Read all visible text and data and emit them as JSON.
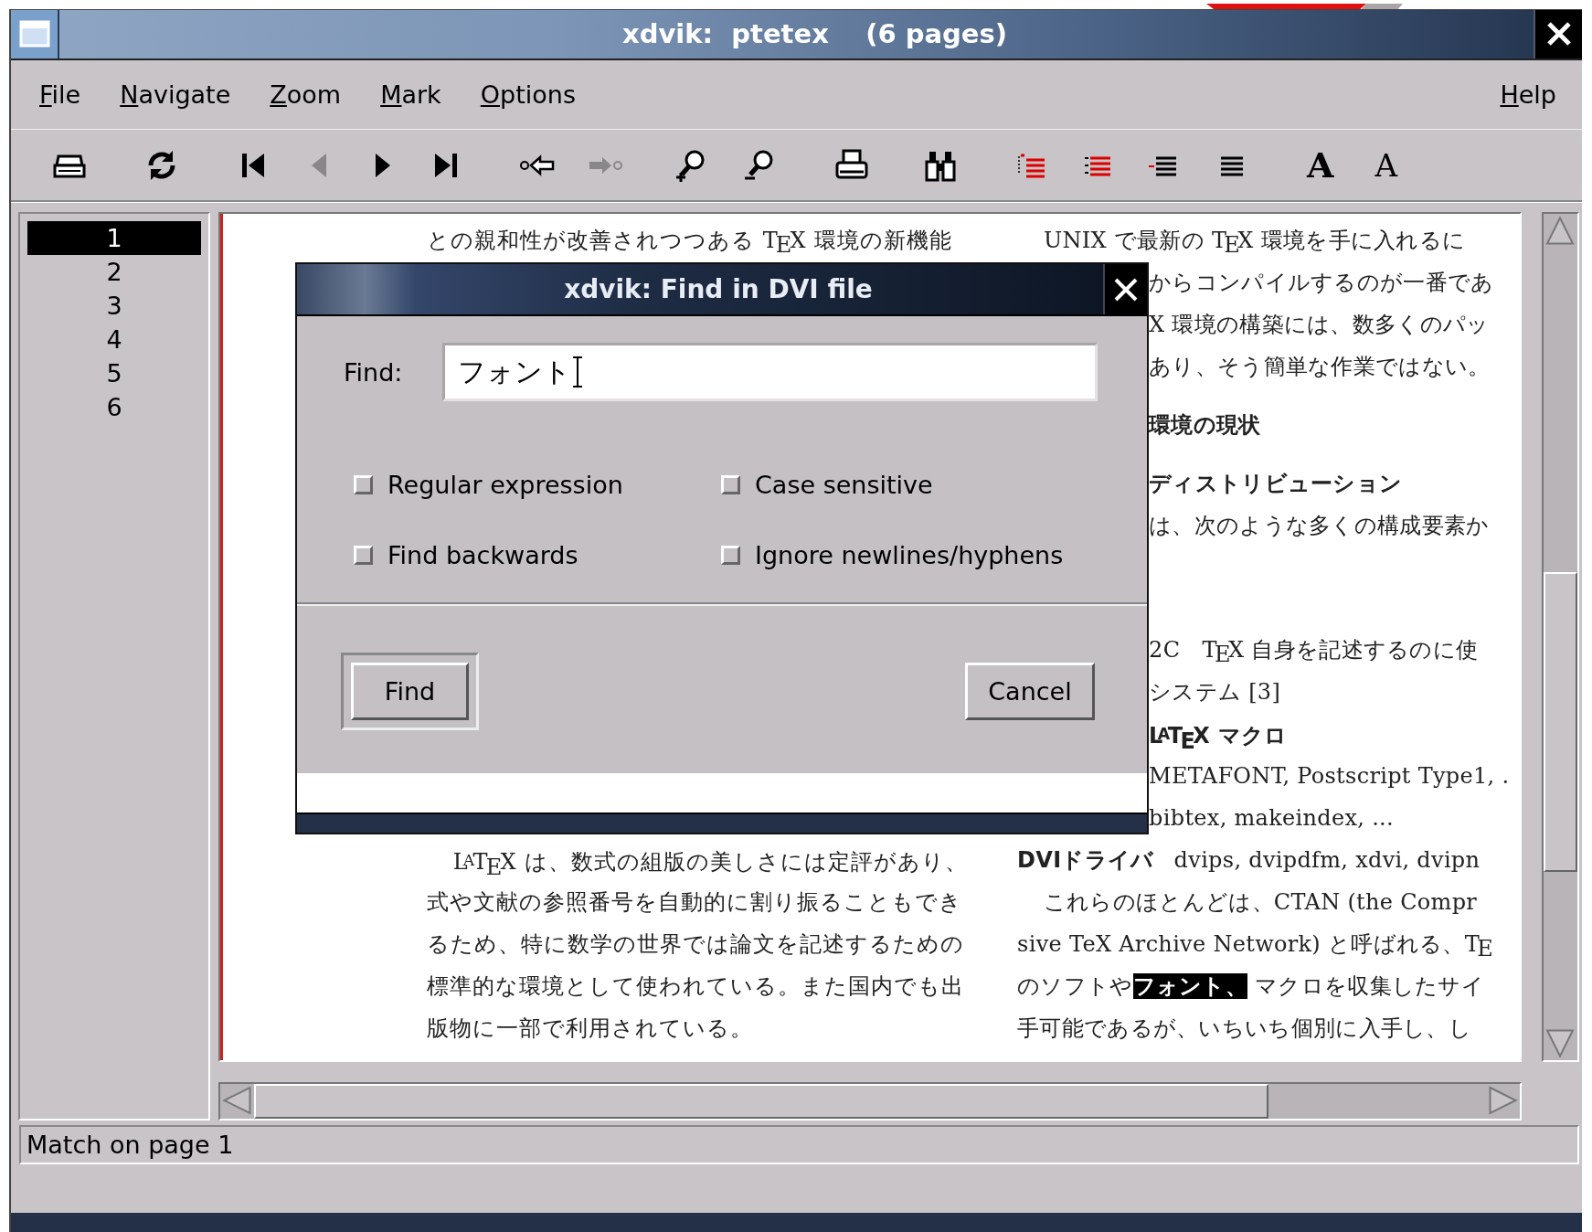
{
  "window": {
    "title": "xdvik:  ptetex    (6 pages)"
  },
  "menu": [
    {
      "label": "File"
    },
    {
      "label": "Navigate"
    },
    {
      "label": "Zoom"
    },
    {
      "label": "Mark"
    },
    {
      "label": "Options"
    }
  ],
  "help_menu": {
    "label": "Help"
  },
  "toolbar": [
    {
      "kind": "icon",
      "disabled": false
    },
    {
      "kind": "icon",
      "disabled": false
    },
    {
      "kind": "icon",
      "disabled": false
    },
    {
      "kind": "icon",
      "disabled": true
    },
    {
      "kind": "icon",
      "disabled": false
    },
    {
      "kind": "icon",
      "disabled": false
    },
    {
      "kind": "icon",
      "disabled": false
    },
    {
      "kind": "icon",
      "disabled": true
    },
    {
      "kind": "icon",
      "disabled": false
    },
    {
      "kind": "icon",
      "disabled": false
    },
    {
      "kind": "icon",
      "disabled": false
    },
    {
      "kind": "icon",
      "disabled": false
    },
    {
      "kind": "icon",
      "disabled": false
    },
    {
      "kind": "icon",
      "disabled": false
    },
    {
      "kind": "icon",
      "disabled": false
    },
    {
      "kind": "icon",
      "disabled": false
    },
    {
      "kind": "glyph",
      "label": "A"
    },
    {
      "kind": "glyph",
      "label": "A"
    }
  ],
  "pages": [
    {
      "label": "1",
      "selected": true
    },
    {
      "label": "2",
      "selected": false
    },
    {
      "label": "3",
      "selected": false
    },
    {
      "label": "4",
      "selected": false
    },
    {
      "label": "5",
      "selected": false
    },
    {
      "label": "6",
      "selected": false
    }
  ],
  "document": {
    "left_column": {
      "top": [
        {
          "kind": "text",
          "text": "との親和性が改善されつつある T$_{E}$X 環境の新機能"
        }
      ],
      "bottom": [
        {
          "kind": "indent",
          "text": "L$^{A}$T$_{E}$X は、数式の組版の美しさには定評があり、"
        },
        {
          "kind": "text",
          "text": "式や文献の参照番号を自動的に割り振ることもでき"
        },
        {
          "kind": "text",
          "text": "るため、特に数学の世界では論文を記述するための"
        },
        {
          "kind": "text",
          "text": "標準的な環境として使われている。また国内でも出"
        },
        {
          "kind": "text",
          "text": "版物に一部で利用されている。"
        }
      ]
    },
    "right_column": {
      "top": [
        {
          "kind": "indent",
          "text": "UNIX で最新の T$_{E}$X 環境を手に入れるに"
        },
        {
          "kind": "text",
          "text": "からコンパイルするのが一番であ",
          "partly_hidden": true
        },
        {
          "kind": "text",
          "text": "X 環境の構築には、数多くのパッ",
          "partly_hidden": true
        },
        {
          "kind": "text",
          "text": "あり、そう簡単な作業ではない。",
          "partly_hidden": true
        },
        {
          "kind": "heading",
          "text": "環境の現状",
          "partly_hidden": true
        },
        {
          "kind": "heading",
          "text": "ディストリビューション",
          "partly_hidden": true
        },
        {
          "kind": "text",
          "text": "は、次のような多くの構成要素か",
          "partly_hidden": true
        }
      ],
      "bottom": [
        {
          "kind": "text",
          "text": "2C　T$_{E}$X 自身を記述するのに使",
          "partly_hidden": true
        },
        {
          "kind": "text",
          "text": "システム [3]",
          "partly_hidden": true
        },
        {
          "kind": "term",
          "text": "L$^{A}$T$_{E}$X マクロ",
          "partly_hidden": true
        },
        {
          "kind": "text",
          "text": "METAFONT, Postscript Type1, .",
          "partly_hidden": true
        },
        {
          "kind": "text",
          "text": "bibtex, makeindex, ...",
          "partly_hidden": true
        },
        {
          "kind": "label-row",
          "label": "DVIドライバ",
          "text": "dvips, dvipdfm, xdvi, dvipn"
        },
        {
          "kind": "indent",
          "text": "これらのほとんどは、CTAN (the Compr"
        },
        {
          "kind": "text",
          "text": "sive TeX Archive Network) と呼ばれる、T$_{E}$"
        },
        {
          "kind": "segments",
          "segments": [
            {
              "text": "のソフトや",
              "highlighted": false
            },
            {
              "text": "フォント、",
              "highlighted": true
            },
            {
              "text": " マクロを収集したサイ",
              "highlighted": false
            }
          ]
        },
        {
          "kind": "text",
          "text": "手可能であるが、いちいち個別に入手し、し"
        }
      ]
    }
  },
  "dialog": {
    "title": "xdvik: Find in DVI file",
    "find_label": "Find:",
    "find_value": "フォント",
    "options": [
      {
        "label": "Regular expression",
        "checked": false
      },
      {
        "label": "Case sensitive",
        "checked": false
      },
      {
        "label": "Find backwards",
        "checked": false
      },
      {
        "label": "Ignore newlines/hyphens",
        "checked": false
      }
    ],
    "buttons": [
      {
        "label": "Find",
        "default": true
      },
      {
        "label": "Cancel",
        "default": false
      }
    ]
  },
  "status_bar": {
    "text": "Match on page 1"
  }
}
